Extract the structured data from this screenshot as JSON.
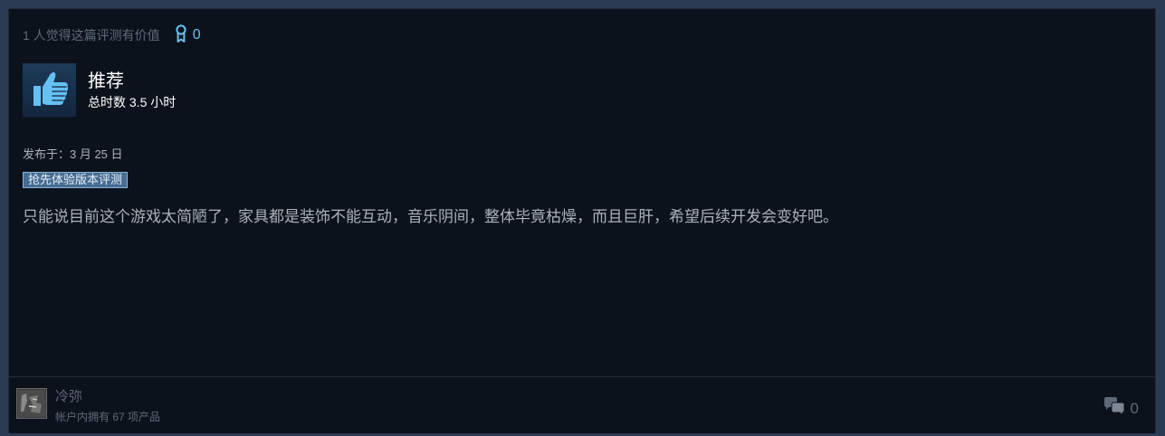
{
  "review": {
    "helpful_text": "1 人觉得这篇评测有价值",
    "award_count": "0",
    "verdict": "推荐",
    "hours": "总时数 3.5 小时",
    "posted": "发布于：3 月 25 日",
    "early_access_badge": "抢先体验版本评测",
    "body": "只能说目前这个游戏太简陋了，家具都是装饰不能互动，音乐阴间，整体毕竟枯燥，而且巨肝，希望后续开发会变好吧。"
  },
  "author": {
    "name": "冷弥",
    "products": "帐户内拥有 67 项产品"
  },
  "footer": {
    "comment_count": "0"
  },
  "icons": {
    "award": "award-ribbon-icon",
    "thumb": "thumbs-up-icon",
    "comment": "comment-bubbles-icon"
  },
  "colors": {
    "accent": "#66c0f4",
    "card_background": "#0c121c",
    "muted_text": "#5e6a77",
    "badge_background": "#456d93"
  }
}
